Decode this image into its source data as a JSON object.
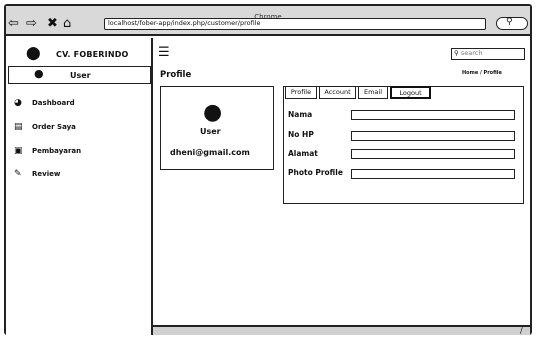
{
  "browser": {
    "title": "Chrome",
    "url": "localhost/fober-app/index.php/customer/profile",
    "icons": [
      "back-icon",
      "forward-icon",
      "close-icon",
      "home-icon",
      "search-icon"
    ]
  },
  "sidebar": {
    "brand": "CV. FOBERINDO",
    "user_label": "User",
    "items": [
      {
        "label": "Dashboard",
        "icon": "dashboard-icon"
      },
      {
        "label": "Order Saya",
        "icon": "cart-icon"
      },
      {
        "label": "Pembayaran",
        "icon": "payment-icon"
      },
      {
        "label": "Review",
        "icon": "edit-icon"
      }
    ]
  },
  "header": {
    "search_placeholder": "search",
    "page_title": "Profile",
    "breadcrumb": "Home / Profile"
  },
  "profile_card": {
    "name": "User",
    "email": "dheni@gmail.com"
  },
  "form": {
    "tabs": [
      {
        "label": "Profile"
      },
      {
        "label": "Account"
      },
      {
        "label": "Email"
      },
      {
        "label": "Logout"
      }
    ],
    "fields": [
      {
        "label": "Nama"
      },
      {
        "label": "No HP"
      },
      {
        "label": "Alamat"
      },
      {
        "label": "Photo Profile"
      }
    ]
  }
}
